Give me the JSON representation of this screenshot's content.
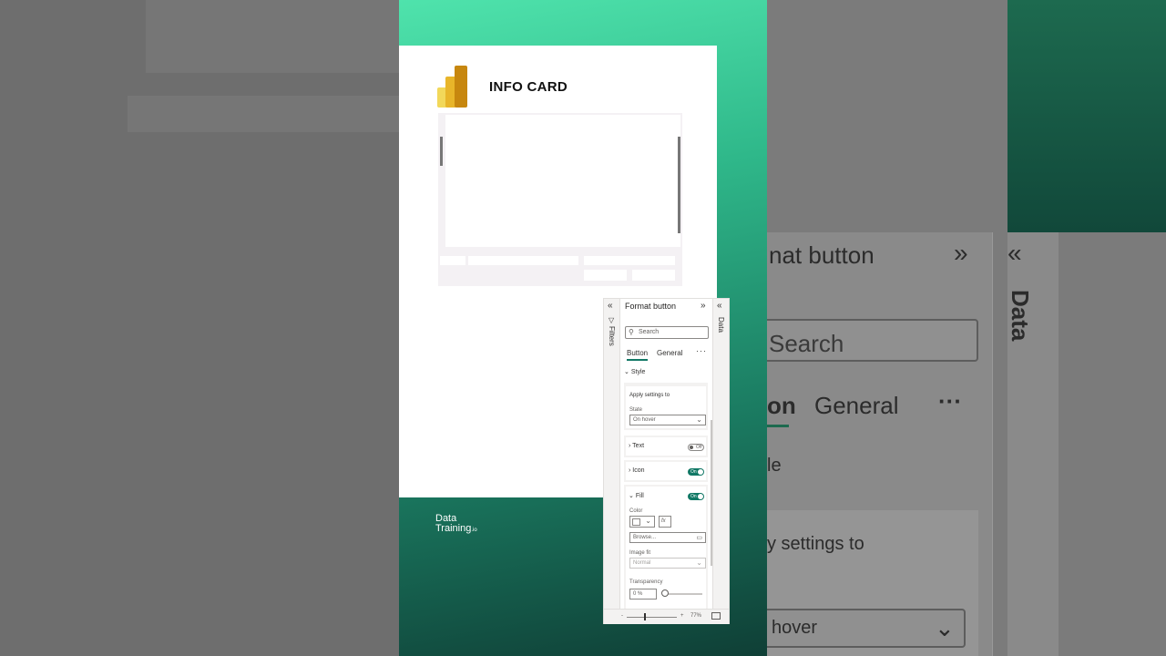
{
  "card": {
    "title": "INFO CARD"
  },
  "brand": {
    "line1": "Data",
    "line2": "Training",
    "suffix": ".io"
  },
  "format_pane": {
    "title": "Format button",
    "filters_label": "Filters",
    "data_label": "Data",
    "search_placeholder": "Search",
    "tabs": [
      {
        "label": "Button",
        "active": true
      },
      {
        "label": "General",
        "active": false
      }
    ],
    "more": "···",
    "style_section": "Style",
    "apply_settings_label": "Apply settings to",
    "state_label": "State",
    "state_value": "On hover",
    "text_label": "Text",
    "text_toggle": "Off",
    "icon_label": "Icon",
    "icon_toggle": "On",
    "fill_label": "Fill",
    "fill_toggle": "On",
    "color_label": "Color",
    "fx": "fx",
    "browse_label": "Browse...",
    "image_fit_label": "Image fit",
    "image_fit_value": "Normal",
    "transparency_label": "Transparency",
    "transparency_value": "0 %",
    "zoom_minus": "-",
    "zoom_plus": "+",
    "zoom_level": "77%"
  },
  "background_right": {
    "title_fragment": "nat button",
    "data_label": "Data",
    "search_fragment": "Search",
    "tab_fragment": "on",
    "general": "General",
    "more": "···",
    "style_fragment": "le",
    "apply_fragment": "y settings to",
    "state_fragment": "hover"
  },
  "colors": {
    "accent": "#117865",
    "gradient_top": "#4fe3ac",
    "gradient_bottom": "#0f3f36"
  }
}
